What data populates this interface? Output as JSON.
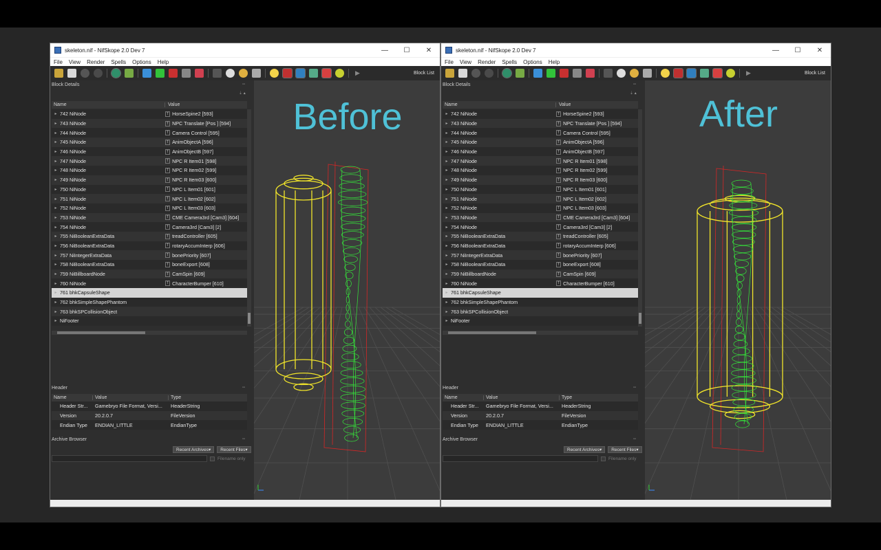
{
  "windows": [
    {
      "id": "before",
      "title": "skeleton.nif - NifSkope 2.0 Dev 7",
      "overlay_label": "Before",
      "fixed": false
    },
    {
      "id": "after",
      "title": "skeleton.nif - NifSkope 2.0 Dev 7",
      "overlay_label": "After",
      "fixed": true
    }
  ],
  "menu": [
    "File",
    "View",
    "Render",
    "Spells",
    "Options",
    "Help"
  ],
  "toolbar": {
    "block_list_label": "Block List"
  },
  "window_buttons": {
    "minimize": "—",
    "maximize": "☐",
    "close": "✕"
  },
  "block_details": {
    "title": "Block Details",
    "columns": {
      "name": "Name",
      "value": "Value"
    },
    "rows": [
      {
        "name": "742 NiNode",
        "value": "HorseSpine2 [593]",
        "icon": true
      },
      {
        "name": "743 NiNode",
        "value": "NPC Translate [Pos ] [594]",
        "icon": true
      },
      {
        "name": "744 NiNode",
        "value": "Camera Control [595]",
        "icon": true
      },
      {
        "name": "745 NiNode",
        "value": "AnimObjectA [596]",
        "icon": true
      },
      {
        "name": "746 NiNode",
        "value": "AnimObjectB [597]",
        "icon": true
      },
      {
        "name": "747 NiNode",
        "value": "NPC R Item01 [598]",
        "icon": true
      },
      {
        "name": "748 NiNode",
        "value": "NPC R Item02 [599]",
        "icon": true
      },
      {
        "name": "749 NiNode",
        "value": "NPC R Item03 [600]",
        "icon": true
      },
      {
        "name": "750 NiNode",
        "value": "NPC L Item01 [601]",
        "icon": true
      },
      {
        "name": "751 NiNode",
        "value": "NPC L Item02 [602]",
        "icon": true
      },
      {
        "name": "752 NiNode",
        "value": "NPC L Item03 [603]",
        "icon": true
      },
      {
        "name": "753 NiNode",
        "value": "CME Camera3rd [Cam3] [604]",
        "icon": true
      },
      {
        "name": "754 NiNode",
        "value": "Camera3rd [Cam3] [2]",
        "icon": true
      },
      {
        "name": "755 NiBooleanExtraData",
        "value": "treadController [605]",
        "icon": true
      },
      {
        "name": "756 NiBooleanExtraData",
        "value": "rotaryAccumInterp [606]",
        "icon": true
      },
      {
        "name": "757 NiIntegerExtraData",
        "value": "bonePriority [607]",
        "icon": true
      },
      {
        "name": "758 NiBooleanExtraData",
        "value": "boneExport [608]",
        "icon": true
      },
      {
        "name": "759 NiBillboardNode",
        "value": "CamSpin [609]",
        "icon": true
      },
      {
        "name": "760 NiNode",
        "value": "CharacterBumper [610]",
        "icon": true
      },
      {
        "name": "761 bhkCapsuleShape",
        "value": "",
        "icon": false,
        "selected": true
      },
      {
        "name": "762 bhkSimpleShapePhantom",
        "value": "",
        "icon": false
      },
      {
        "name": "763 bhkSPCollisionObject",
        "value": "",
        "icon": false
      },
      {
        "name": "NiFooter",
        "value": "",
        "icon": false
      }
    ]
  },
  "header": {
    "title": "Header",
    "columns": {
      "name": "Name",
      "value": "Value",
      "type": "Type"
    },
    "rows": [
      {
        "name": "Header Str...",
        "value": "Gamebryo File Format, Versi...",
        "type": "HeaderString"
      },
      {
        "name": "Version",
        "value": "20.2.0.7",
        "type": "FileVersion"
      },
      {
        "name": "Endian Type",
        "value": "ENDIAN_LITTLE",
        "type": "EndianType"
      }
    ]
  },
  "archive": {
    "title": "Archive Browser",
    "recent_archives": "Recent Archives▾",
    "recent_files": "Recent Files▾",
    "filename_only": "Filename only"
  },
  "colors": {
    "overlay_text": "#4fc1d7",
    "capsule": "#f2e52a",
    "skeleton": "#35e83a",
    "bounds": "#d62626",
    "selection": "#d5d5d5"
  }
}
